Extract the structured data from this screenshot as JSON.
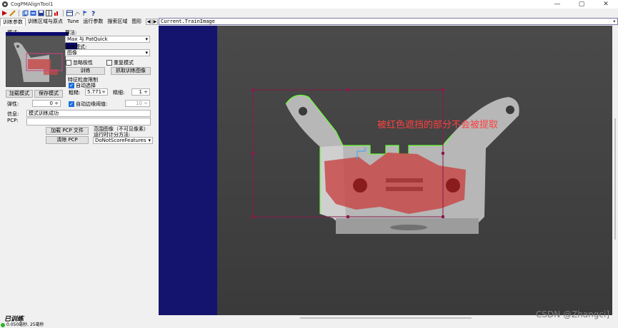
{
  "window": {
    "title": "CogPMAlignTool1",
    "minimize": "—",
    "maximize": "▢",
    "close": "✕"
  },
  "toolbar": {
    "icons": [
      "run-icon",
      "edit-icon",
      "copy-icon",
      "image-icon",
      "save-icon",
      "grid-icon",
      "chart-icon",
      "help-icon"
    ]
  },
  "tabs": [
    {
      "label": "训练参数",
      "active": true
    },
    {
      "label": "训练区域与原点",
      "active": false
    },
    {
      "label": "Tune",
      "active": false
    },
    {
      "label": "运行参数",
      "active": false
    },
    {
      "label": "搜索区域",
      "active": false
    },
    {
      "label": "图形",
      "active": false
    }
  ],
  "tab_scroll": {
    "left": "◀",
    "right": "▶"
  },
  "train": {
    "pattern_label": "模式:",
    "algorithm_label": "算法:",
    "algorithm_value": "Max 与 PatQuick",
    "train_mode_label": "训练模式:",
    "train_mode_value": "图像",
    "ignore_polarity_label": "忽略极性",
    "repeat_mode_label": "重复模式",
    "train_button": "训练",
    "grab_train_image_button": "抓取训练图像",
    "load_pattern_button": "加载模式",
    "save_pattern_button": "保存模式",
    "feature_limit_label": "特征粒度限制",
    "auto_select_label": "自动选择",
    "coarse_label": "粗糙:",
    "coarse_value": "5.771",
    "fine_label": "精细:",
    "fine_value": "1",
    "elasticity_label": "弹性:",
    "elasticity_value": "0",
    "auto_edge_threshold_label": "自动边缘阈值:",
    "auto_edge_threshold_value": "10",
    "info_label": "信息:",
    "info_value": "模式训练成功",
    "pcp_label": "PCP:",
    "pcp_value": "",
    "load_pcp_button": "加载 PCP 文件",
    "clear_pcp_button": "清除 PCP",
    "range_image_label": "范围图像（不可见像素）",
    "runtime_method_label": "运行时计分方法:",
    "runtime_method_value": "DoNotScoreFeatures"
  },
  "image_view": {
    "selector_value": "Current.TrainImage",
    "annotation_text": "被红色遮挡的部分不会被提取"
  },
  "status": {
    "state_label": "已训练",
    "timing_text": "0.050毫秒, 25毫秒"
  },
  "watermark": "CSDN @Zhangci]",
  "colors": {
    "display_bg": "#14146e",
    "mask": "#c84646",
    "roi": "#8b1a4a",
    "edges": "#66ff33",
    "annotation": "#ff4040",
    "status_ok": "#2bb32b"
  }
}
